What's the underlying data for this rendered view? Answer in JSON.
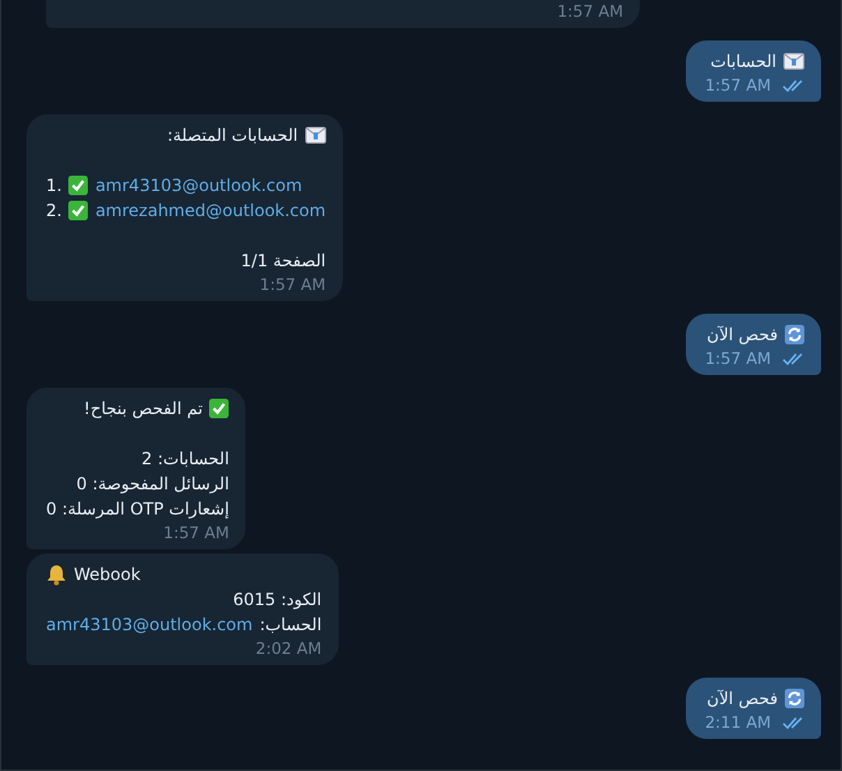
{
  "messages": [
    {
      "kind": "incoming",
      "time": "1:57 AM"
    },
    {
      "kind": "outgoing",
      "time": "1:57 AM",
      "read": true,
      "paragraphs": [
        [
          {
            "kind": "envelope-title",
            "text": "الحسابات"
          }
        ]
      ]
    },
    {
      "kind": "incoming",
      "time": "1:57 AM",
      "paragraphs": [
        [
          {
            "kind": "envelope-title",
            "text": "الحسابات المتصلة:"
          }
        ],
        [
          {
            "kind": "list-item",
            "prefix": "1.",
            "link": "amr43103@outlook.com"
          },
          {
            "kind": "list-item",
            "prefix": "2.",
            "link": "amrezahmed@outlook.com"
          }
        ],
        [
          {
            "kind": "plain",
            "text": "الصفحة 1/1"
          }
        ]
      ]
    },
    {
      "kind": "outgoing",
      "time": "1:57 AM",
      "read": true,
      "paragraphs": [
        [
          {
            "kind": "refresh-title",
            "text": "فحص الآن"
          }
        ]
      ]
    },
    {
      "kind": "incoming",
      "time": "1:57 AM",
      "paragraphs": [
        [
          {
            "kind": "check-title",
            "text": "تم الفحص بنجاح!"
          }
        ],
        [
          {
            "kind": "plain",
            "text": "الحسابات: 2"
          },
          {
            "kind": "plain",
            "text": "الرسائل المفحوصة: 0"
          },
          {
            "kind": "plain",
            "text": "إشعارات OTP المرسلة: 0"
          }
        ]
      ]
    },
    {
      "kind": "incoming",
      "time": "2:02 AM",
      "paragraphs": [
        [
          {
            "kind": "bell-title",
            "text": "Webook"
          },
          {
            "kind": "plain",
            "text": "الكود: 6015"
          },
          {
            "kind": "link-field",
            "text": "الحساب:",
            "link": "amr43103@outlook.com"
          }
        ]
      ]
    },
    {
      "kind": "outgoing",
      "time": "2:11 AM",
      "read": true,
      "paragraphs": [
        [
          {
            "kind": "refresh-title",
            "text": "فحص الآن"
          }
        ]
      ]
    }
  ]
}
